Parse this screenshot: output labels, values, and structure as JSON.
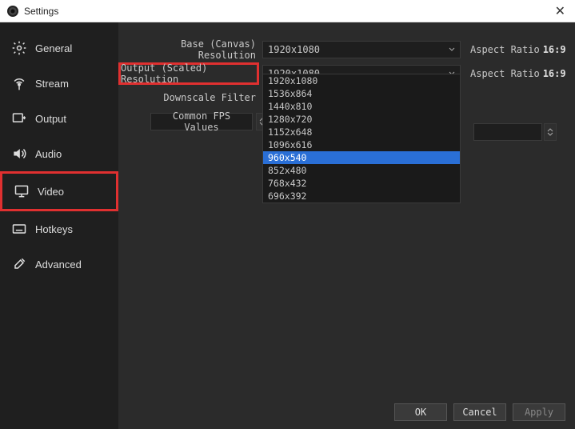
{
  "window": {
    "title": "Settings",
    "close_label": "✕"
  },
  "sidebar": {
    "items": [
      {
        "label": "General",
        "icon": "gear-icon"
      },
      {
        "label": "Stream",
        "icon": "antenna-icon"
      },
      {
        "label": "Output",
        "icon": "output-icon"
      },
      {
        "label": "Audio",
        "icon": "speaker-icon"
      },
      {
        "label": "Video",
        "icon": "monitor-icon",
        "selected": true
      },
      {
        "label": "Hotkeys",
        "icon": "keyboard-icon"
      },
      {
        "label": "Advanced",
        "icon": "tools-icon"
      }
    ]
  },
  "video": {
    "base_label": "Base (Canvas) Resolution",
    "base_value": "1920x1080",
    "base_aspect_label": "Aspect Ratio",
    "base_aspect_value": "16:9",
    "output_label": "Output (Scaled) Resolution",
    "output_value": "1920x1080",
    "output_aspect_label": "Aspect Ratio",
    "output_aspect_value": "16:9",
    "downscale_label": "Downscale Filter",
    "fps_label": "Common FPS Values",
    "output_options": [
      "1920x1080",
      "1536x864",
      "1440x810",
      "1280x720",
      "1152x648",
      "1096x616",
      "960x540",
      "852x480",
      "768x432",
      "696x392"
    ],
    "output_highlighted": "960x540"
  },
  "footer": {
    "ok": "OK",
    "cancel": "Cancel",
    "apply": "Apply"
  }
}
